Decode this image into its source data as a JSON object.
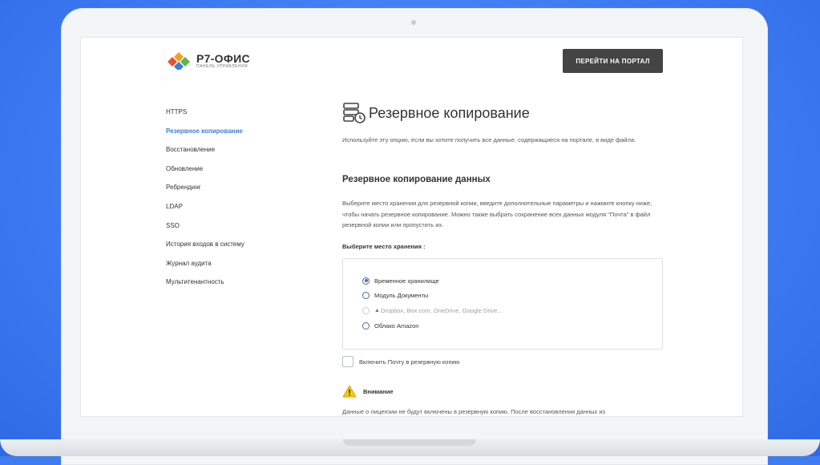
{
  "logo": {
    "name": "Р7-ОФИС",
    "subtitle": "ПАНЕЛЬ УПРАВЛЕНИЯ"
  },
  "header": {
    "portal_button": "ПЕРЕЙТИ НА ПОРТАЛ"
  },
  "sidebar": {
    "items": [
      {
        "label": "HTTPS",
        "active": false
      },
      {
        "label": "Резервное копирование",
        "active": true
      },
      {
        "label": "Восстановление",
        "active": false
      },
      {
        "label": "Обновление",
        "active": false
      },
      {
        "label": "Ребрендинг",
        "active": false
      },
      {
        "label": "LDAP",
        "active": false
      },
      {
        "label": "SSO",
        "active": false
      },
      {
        "label": "История входов в систему",
        "active": false
      },
      {
        "label": "Журнал аудита",
        "active": false
      },
      {
        "label": "Мультитенантность",
        "active": false
      }
    ]
  },
  "main": {
    "title": "Резервное копирование",
    "title_icon": "backup-server-icon",
    "description": "Используйте эту опцию, если вы хотите получить все данные, содержащиеся на портале, в виде файла.",
    "section_title": "Резервное копирование данных",
    "section_description": "Выберите место хранения для резервной копии, введите дополнительные параметры и нажмите кнопку ниже, чтобы начать резервное копирование. Можно также выбрать сохранение всех данных модуля \"Почта\" в файл резервной копии или пропустить их.",
    "storage_label": "Выберите место хранения :",
    "storage_options": [
      {
        "label": "Временное хранилище",
        "checked": true,
        "disabled": false
      },
      {
        "label": "Модуль Документы",
        "checked": false,
        "disabled": false
      },
      {
        "label": "Dropbox, Box.com, OneDrive, Google Drive...",
        "checked": false,
        "disabled": true
      },
      {
        "label": "Облако Amazon",
        "checked": false,
        "disabled": false
      }
    ],
    "include_mail_label": "Включить Почту в резервную копию",
    "include_mail_checked": false,
    "warning_title": "Внимание",
    "warning_text": "Данные о лицензии не будут включены в резервную копию. После восстановления данных из"
  },
  "colors": {
    "background": "#3f7cf2",
    "accent": "#3a7ce0",
    "button": "#444444"
  }
}
